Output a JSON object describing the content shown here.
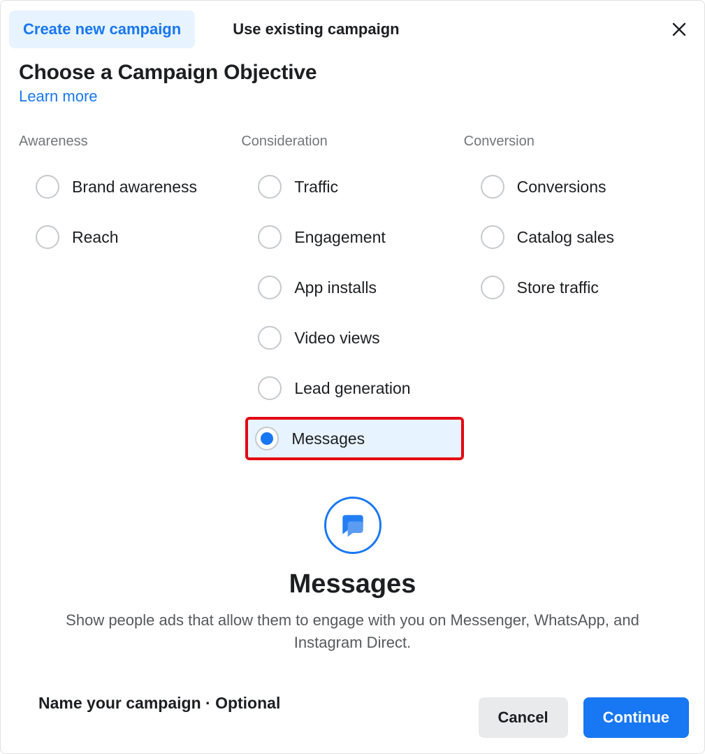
{
  "tabs": {
    "create": "Create new campaign",
    "existing": "Use existing campaign"
  },
  "heading": "Choose a Campaign Objective",
  "learn_more": "Learn more",
  "columns": {
    "awareness": {
      "title": "Awareness",
      "items": [
        "Brand awareness",
        "Reach"
      ]
    },
    "consideration": {
      "title": "Consideration",
      "items": [
        "Traffic",
        "Engagement",
        "App installs",
        "Video views",
        "Lead generation",
        "Messages"
      ]
    },
    "conversion": {
      "title": "Conversion",
      "items": [
        "Conversions",
        "Catalog sales",
        "Store traffic"
      ]
    }
  },
  "selected_objective": "Messages",
  "detail": {
    "title": "Messages",
    "description": "Show people ads that allow them to engage with you on Messenger, WhatsApp, and Instagram Direct."
  },
  "name_section": "Name your campaign · Optional",
  "footer": {
    "cancel": "Cancel",
    "continue": "Continue"
  }
}
